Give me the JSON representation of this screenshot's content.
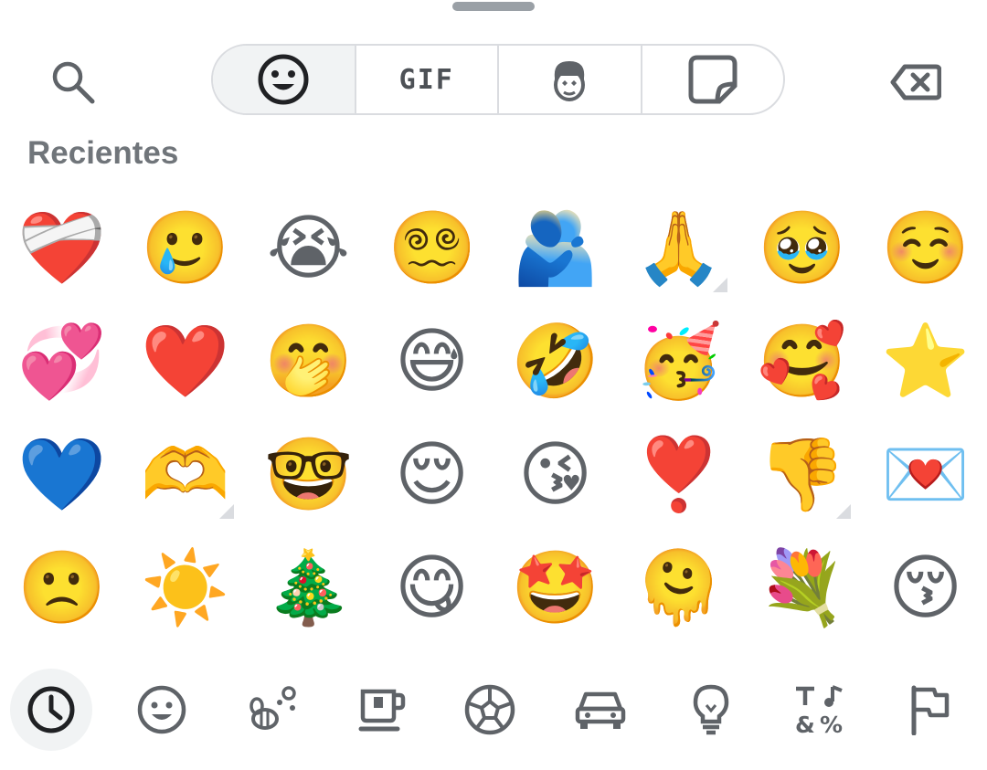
{
  "header": {
    "search_icon": "search-icon",
    "tabs": [
      {
        "id": "emoji",
        "icon": "smiley-icon",
        "active": true
      },
      {
        "id": "gif",
        "label": "GIF",
        "active": false
      },
      {
        "id": "avatar",
        "icon": "avatar-sticker-icon",
        "active": false
      },
      {
        "id": "stickers",
        "icon": "sticker-icon",
        "active": false
      }
    ],
    "backspace_icon": "backspace-icon"
  },
  "section_title": "Recientes",
  "emojis": [
    {
      "char": "❤️‍🩹",
      "name": "mending-heart"
    },
    {
      "char": "🥲",
      "name": "smiling-face-with-tear"
    },
    {
      "char": "😭",
      "name": "loudly-crying-face"
    },
    {
      "char": "😵‍💫",
      "name": "face-with-spiral-eyes"
    },
    {
      "char": "🫂",
      "name": "people-hugging"
    },
    {
      "char": "🙏",
      "name": "folded-hands",
      "has_variants": true
    },
    {
      "char": "🥹",
      "name": "face-holding-back-tears"
    },
    {
      "char": "☺️",
      "name": "smiling-face"
    },
    {
      "char": "💞",
      "name": "revolving-hearts"
    },
    {
      "char": "❤️",
      "name": "red-heart"
    },
    {
      "char": "🤭",
      "name": "face-with-hand-over-mouth"
    },
    {
      "char": "😅",
      "name": "grinning-face-with-sweat"
    },
    {
      "char": "🤣",
      "name": "rolling-on-the-floor-laughing"
    },
    {
      "char": "🥳",
      "name": "partying-face"
    },
    {
      "char": "🥰",
      "name": "smiling-face-with-hearts"
    },
    {
      "char": "⭐",
      "name": "star"
    },
    {
      "char": "💙",
      "name": "blue-heart"
    },
    {
      "char": "🫶",
      "name": "heart-hands",
      "has_variants": true
    },
    {
      "char": "🤓",
      "name": "nerd-face"
    },
    {
      "char": "😌",
      "name": "relieved-face"
    },
    {
      "char": "😘",
      "name": "face-blowing-a-kiss"
    },
    {
      "char": "❣️",
      "name": "heart-exclamation"
    },
    {
      "char": "👎",
      "name": "thumbs-down",
      "has_variants": true
    },
    {
      "char": "💌",
      "name": "love-letter"
    },
    {
      "char": "🙁",
      "name": "slightly-frowning-face"
    },
    {
      "char": "☀️",
      "name": "sun"
    },
    {
      "char": "🎄",
      "name": "christmas-tree"
    },
    {
      "char": "😋",
      "name": "face-savoring-food"
    },
    {
      "char": "🤩",
      "name": "star-struck"
    },
    {
      "char": "🫠",
      "name": "melting-face"
    },
    {
      "char": "💐",
      "name": "bouquet"
    },
    {
      "char": "😚",
      "name": "kissing-face-with-closed-eyes"
    }
  ],
  "categories": [
    {
      "id": "recent",
      "icon": "clock-icon",
      "active": true
    },
    {
      "id": "smileys",
      "icon": "smiley-icon",
      "active": false
    },
    {
      "id": "animals",
      "icon": "bee-flower-icon",
      "active": false
    },
    {
      "id": "food",
      "icon": "coffee-icon",
      "active": false
    },
    {
      "id": "activities",
      "icon": "soccer-ball-icon",
      "active": false
    },
    {
      "id": "travel",
      "icon": "car-icon",
      "active": false
    },
    {
      "id": "objects",
      "icon": "lightbulb-icon",
      "active": false
    },
    {
      "id": "symbols",
      "icon": "symbols-icon",
      "active": false
    },
    {
      "id": "flags",
      "icon": "flag-icon",
      "active": false
    }
  ],
  "colors": {
    "icon": "#5f6368",
    "active_icon": "#202124",
    "divider": "#dadce0",
    "active_bg": "#f1f3f4"
  }
}
